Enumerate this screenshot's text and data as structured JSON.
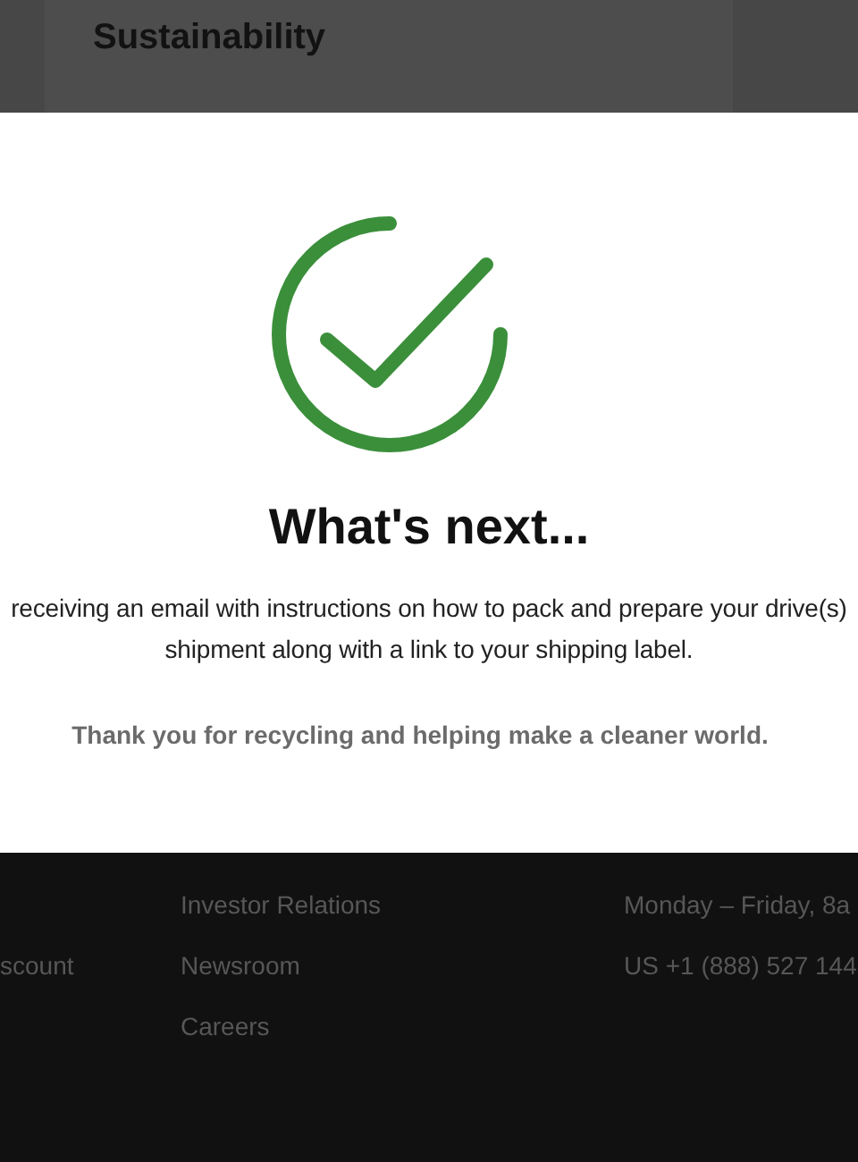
{
  "page_heading": "Sustainability",
  "modal": {
    "title": "What's next...",
    "message_lines": [
      "receiving an email with instructions on how to pack and prepare your drive(s)",
      "shipment along with a link to your shipping label."
    ],
    "thank_you": "Thank you for recycling and helping make a cleaner world."
  },
  "footer": {
    "columns": [
      {
        "links": [
          "scount"
        ]
      },
      {
        "links": [
          "Investor Relations",
          "Newsroom",
          "Careers"
        ]
      },
      {
        "links": [
          "Monday – Friday, 8a",
          "US +1 (888) 527 144"
        ]
      }
    ]
  }
}
